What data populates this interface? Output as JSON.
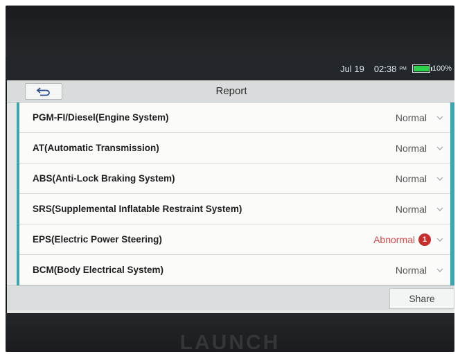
{
  "status_bar": {
    "date": "Jul 19",
    "time": "02:38",
    "ampm": "PM",
    "battery_percent": "100%",
    "battery_level": 1.0,
    "battery_color": "#2ed24a"
  },
  "header": {
    "back_icon": "back-arrow-icon",
    "title": "Report"
  },
  "systems": [
    {
      "label": "PGM-FI/Diesel(Engine System)",
      "status": "Normal"
    },
    {
      "label": "AT(Automatic Transmission)",
      "status": "Normal"
    },
    {
      "label": "ABS(Anti-Lock Braking System)",
      "status": "Normal"
    },
    {
      "label": "SRS(Supplemental Inflatable Restraint System)",
      "status": "Normal"
    },
    {
      "label": "EPS(Electric Power Steering)",
      "status": "Abnormal",
      "fault_count": "1"
    },
    {
      "label": "BCM(Body Electrical System)",
      "status": "Normal"
    }
  ],
  "colors": {
    "accent": "#3aa7b0",
    "abnormal": "#d84a4a",
    "fault_badge": "#c62e2e"
  },
  "footer": {
    "share_label": "Share"
  },
  "device": {
    "brand": "LAUNCH"
  }
}
